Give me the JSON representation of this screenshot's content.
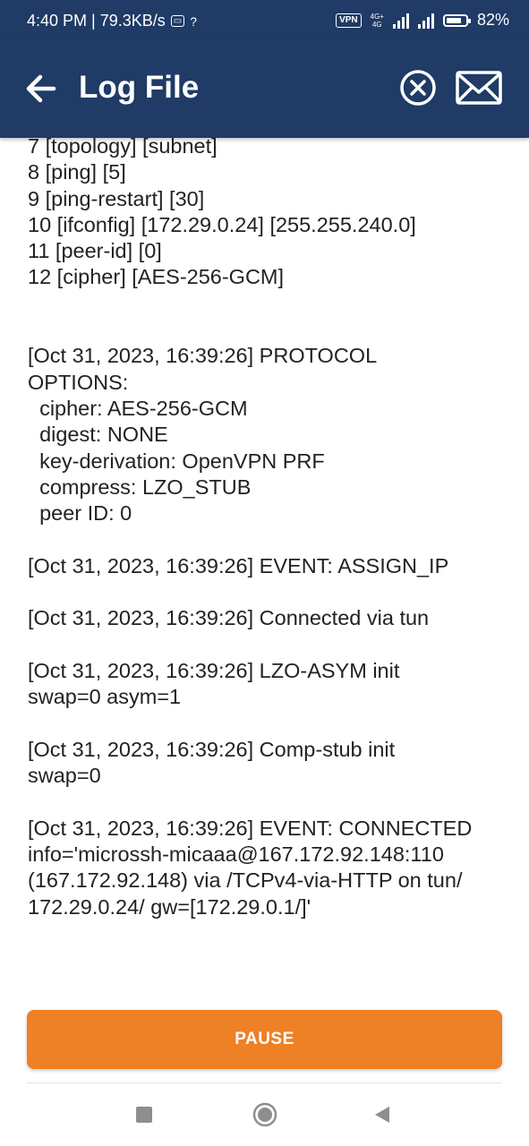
{
  "status_bar": {
    "time_speed": "4:40 PM | 79.3KB/s",
    "vpn_label": "VPN",
    "net_type_top": "4G+",
    "net_type_bottom": "4G",
    "battery_text": "82%",
    "battery_level": 0.82
  },
  "app_bar": {
    "title": "Log File"
  },
  "log": {
    "text": "7 [topology] [subnet]\n8 [ping] [5]\n9 [ping-restart] [30]\n10 [ifconfig] [172.29.0.24] [255.255.240.0]\n11 [peer-id] [0]\n12 [cipher] [AES-256-GCM]\n\n\n[Oct 31, 2023, 16:39:26] PROTOCOL\nOPTIONS:\n  cipher: AES-256-GCM\n  digest: NONE\n  key-derivation: OpenVPN PRF\n  compress: LZO_STUB\n  peer ID: 0\n\n[Oct 31, 2023, 16:39:26] EVENT: ASSIGN_IP\n\n[Oct 31, 2023, 16:39:26] Connected via tun\n\n[Oct 31, 2023, 16:39:26] LZO-ASYM init\nswap=0 asym=1\n\n[Oct 31, 2023, 16:39:26] Comp-stub init\nswap=0\n\n[Oct 31, 2023, 16:39:26] EVENT: CONNECTED\ninfo='microssh-micaaa@167.172.92.148:110\n(167.172.92.148) via /TCPv4-via-HTTP on tun/\n172.29.0.24/ gw=[172.29.0.1/]'"
  },
  "controls": {
    "pause_label": "PAUSE"
  },
  "icons": {
    "back": "arrow-left-icon",
    "close": "close-circle-icon",
    "mail": "envelope-icon",
    "nav_recents": "square-icon",
    "nav_home": "circle-icon",
    "nav_back": "triangle-back-icon"
  },
  "colors": {
    "app_bar": "#1f3b66",
    "accent_button": "#ee8026",
    "text": "#222222",
    "nav_icon": "#8e8e8e"
  }
}
